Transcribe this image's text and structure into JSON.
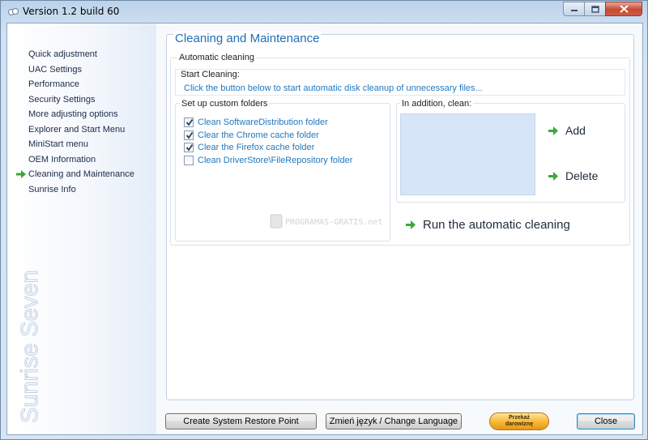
{
  "window": {
    "title": "Version 1.2 build 60"
  },
  "sidebar": {
    "items": [
      {
        "label": "Quick adjustment",
        "active": false
      },
      {
        "label": "UAC Settings",
        "active": false
      },
      {
        "label": "Performance",
        "active": false
      },
      {
        "label": "Security Settings",
        "active": false
      },
      {
        "label": "More adjusting options",
        "active": false
      },
      {
        "label": "Explorer and Start Menu",
        "active": false
      },
      {
        "label": "MiniStart menu",
        "active": false
      },
      {
        "label": "OEM Information",
        "active": false
      },
      {
        "label": "Cleaning and Maintenance",
        "active": true
      },
      {
        "label": "Sunrise Info",
        "active": false
      }
    ],
    "brand": "Sunrise Seven"
  },
  "main": {
    "title": "Cleaning and Maintenance",
    "automatic_group": "Automatic cleaning",
    "start_label": "Start Cleaning:",
    "start_description": "Click the button below to start automatic disk cleanup of unnecessary files...",
    "folders_title": "Set up custom folders",
    "folders": [
      {
        "label": "Clean SoftwareDistribution folder",
        "checked": true
      },
      {
        "label": "Clear the Chrome cache folder",
        "checked": true
      },
      {
        "label": "Clear the Firefox cache folder",
        "checked": true
      },
      {
        "label": "Clean DriverStore\\FileRepository folder",
        "checked": false
      }
    ],
    "watermark": "PROGRAMAS-GRATIS.net",
    "addition_title": "In addition, clean:",
    "add_label": "Add",
    "delete_label": "Delete",
    "run_label": "Run the automatic cleaning"
  },
  "footer": {
    "restore_label": "Create System Restore Point",
    "language_label": "Zmień język / Change Language",
    "donate_line1": "Przekaż",
    "donate_line2": "darowiznę",
    "close_label": "Close"
  },
  "colors": {
    "accent": "#1f6fb8",
    "link": "#1f78c0",
    "arrow_green": "#3ca63c"
  }
}
